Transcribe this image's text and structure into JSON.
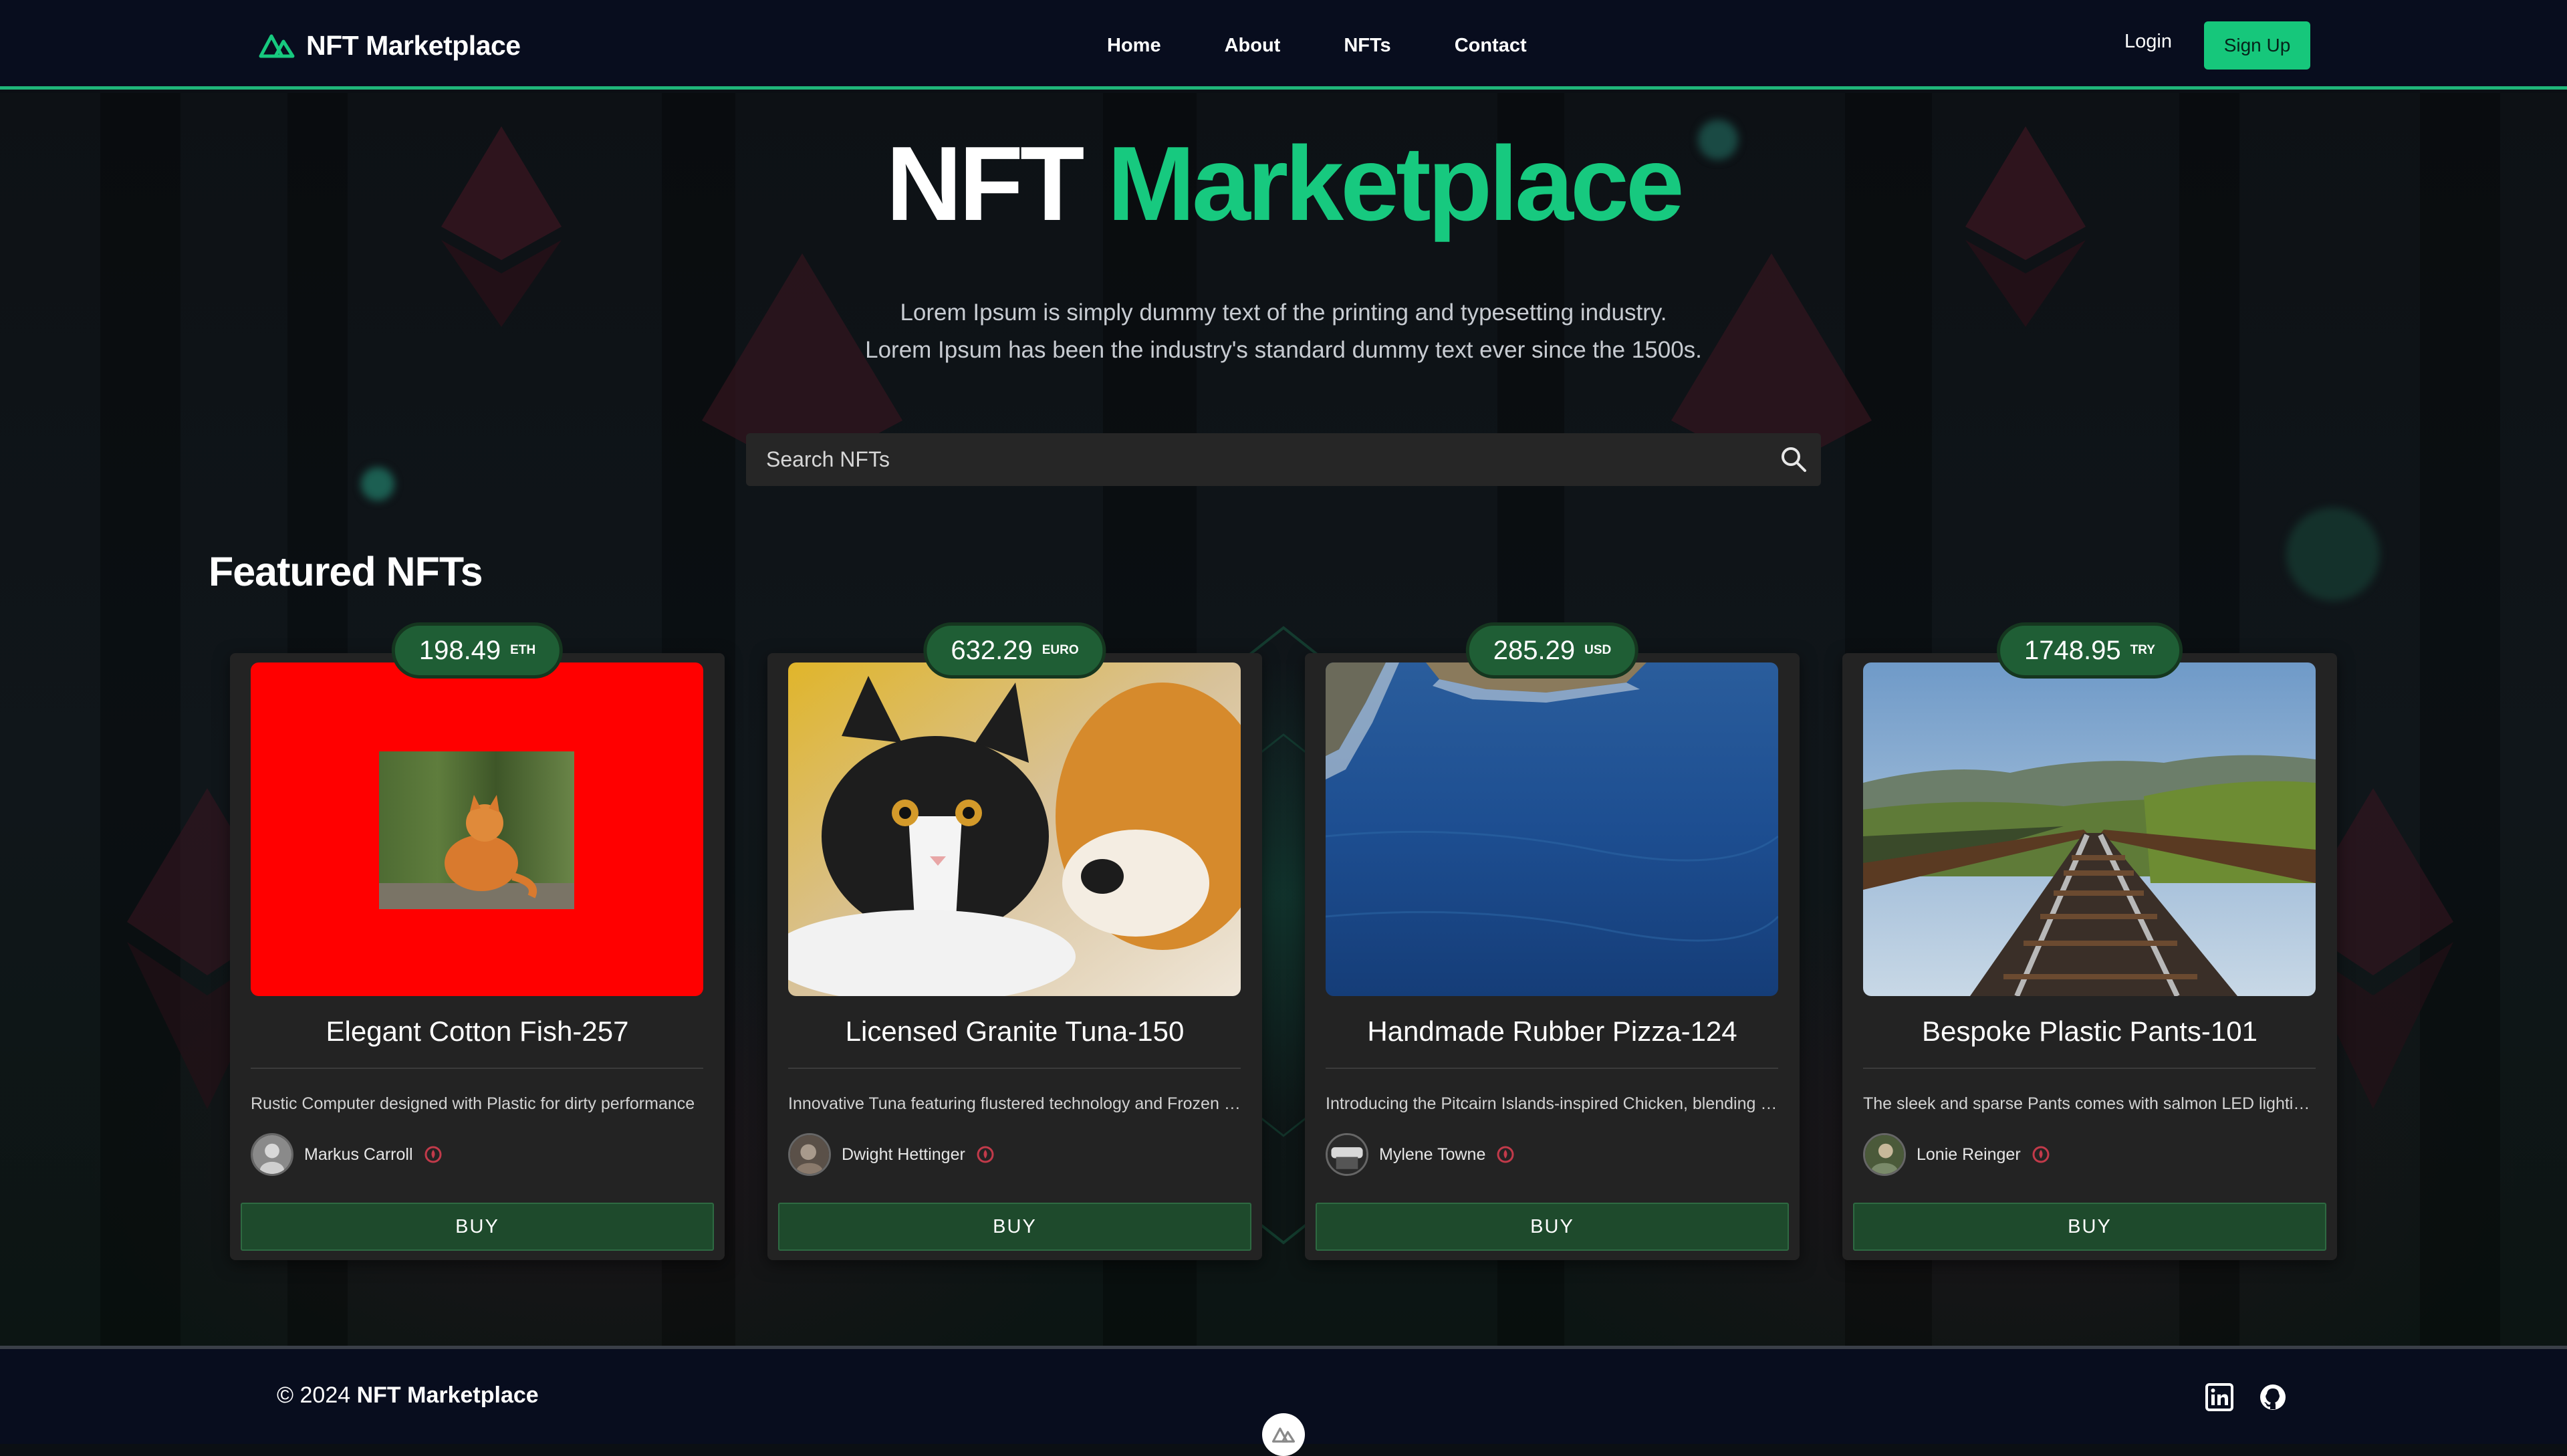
{
  "header": {
    "brand": "NFT Marketplace",
    "nav": [
      "Home",
      "About",
      "NFTs",
      "Contact"
    ],
    "login": "Login",
    "signup": "Sign Up"
  },
  "hero": {
    "title_part1": "NFT",
    "title_part2": "Marketplace",
    "subtitle_line1": "Lorem Ipsum is simply dummy text of the printing and typesetting industry.",
    "subtitle_line2": "Lorem Ipsum has been the industry's standard dummy text ever since the 1500s."
  },
  "search": {
    "placeholder": "Search NFTs",
    "icon": "search-icon"
  },
  "featured": {
    "title": "Featured NFTs",
    "buy_label": "BUY",
    "cards": [
      {
        "price": "198.49",
        "currency": "ETH",
        "name": "Elegant Cotton Fish-257",
        "description": "Rustic Computer designed with Plastic for dirty performance",
        "owner": "Markus Carroll",
        "image": "orange cat on red background"
      },
      {
        "price": "632.29",
        "currency": "EURO",
        "name": "Licensed Granite Tuna-150",
        "description": "Innovative Tuna featuring flustered technology and Frozen co...",
        "owner": "Dwight Hettinger",
        "image": "kitten with plush toy"
      },
      {
        "price": "285.29",
        "currency": "USD",
        "name": "Handmade Rubber Pizza-124",
        "description": "Introducing the Pitcairn Islands-inspired Chicken, blending ma...",
        "owner": "Mylene Towne",
        "image": "ocean and cliffs"
      },
      {
        "price": "1748.95",
        "currency": "TRY",
        "name": "Bespoke Plastic Pants-101",
        "description": "The sleek and sparse Pants comes with salmon LED lighting f...",
        "owner": "Lonie Reinger",
        "image": "railway bridge"
      }
    ]
  },
  "footer": {
    "copyright_prefix": "© 2024",
    "copyright_brand": "NFT Marketplace",
    "social": [
      "linkedin-icon",
      "github-icon"
    ]
  },
  "colors": {
    "accent": "#17c97f",
    "nav_bg": "#080d1e",
    "card_bg": "#232323",
    "buy_bg": "#1e4a2c"
  }
}
